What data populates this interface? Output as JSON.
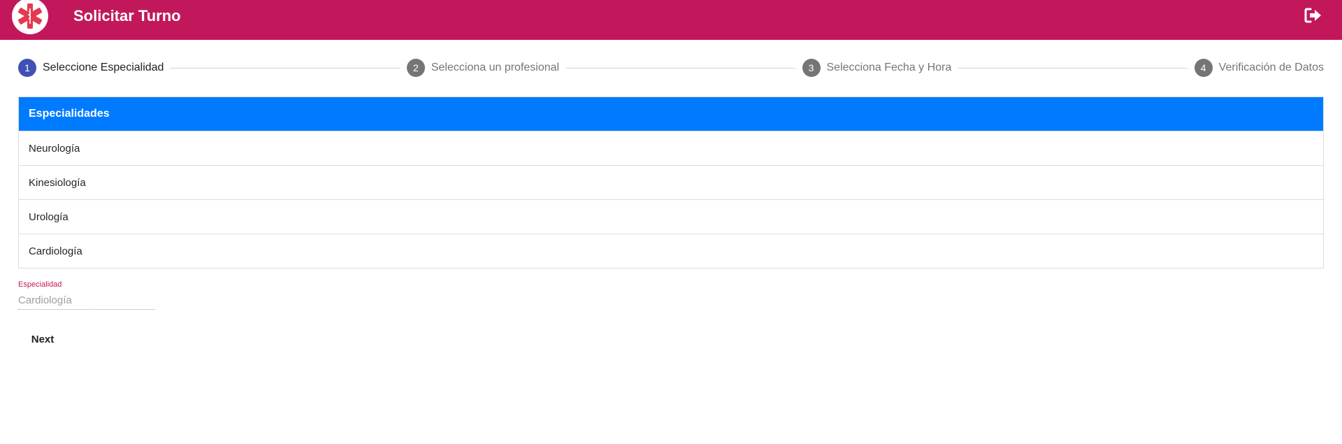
{
  "header": {
    "title": "Solicitar Turno",
    "logo_icon": "medical-star-icon",
    "logout_icon": "sign-out-icon",
    "background_color": "#c2185b"
  },
  "stepper": {
    "steps": [
      {
        "number": "1",
        "label": "Seleccione Especialidad",
        "active": true
      },
      {
        "number": "2",
        "label": "Selecciona un profesional",
        "active": false
      },
      {
        "number": "3",
        "label": "Selecciona Fecha y Hora",
        "active": false
      },
      {
        "number": "4",
        "label": "Verificación de Datos",
        "active": false
      }
    ],
    "active_color": "#3f51b5",
    "inactive_color": "#757575"
  },
  "table": {
    "header": "Especialidades",
    "header_color": "#007bff",
    "rows": [
      "Neurología",
      "Kinesiología",
      "Urología",
      "Cardiología"
    ]
  },
  "specialty_field": {
    "label": "Especialidad",
    "value": "Cardiología"
  },
  "actions": {
    "next_label": "Next"
  }
}
